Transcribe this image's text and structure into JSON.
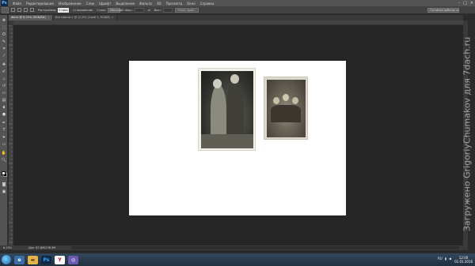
{
  "menubar": {
    "logo": "Ps",
    "items": [
      "Файл",
      "Редактирование",
      "Изображение",
      "Слои",
      "Шрифт",
      "Выделение",
      "Фильтр",
      "3D",
      "Просмотр",
      "Окно",
      "Справка"
    ]
  },
  "options": {
    "feather_label": "Растушевка:",
    "feather_value": "0 пикс",
    "antialias_label": "Сглаживание",
    "style_label": "Стиль:",
    "style_value": "Обычный",
    "width_label": "Шир.:",
    "height_label": "Выс.:",
    "refine_button": "Уточн. край...",
    "workspace": "Основная рабочая среда"
  },
  "tabs": [
    {
      "label": "Фото @ 6,25% (RGB/8#)",
      "active": true
    },
    {
      "label": "Без имени-1 @ 12,5% (Слой 1, RGB/8)",
      "active": false
    }
  ],
  "status": {
    "zoom": "6,25%",
    "doc": "Док: 87,8M/136,9M"
  },
  "taskbar": {
    "apps": [
      "start",
      "explorer",
      "folder",
      "photoshop",
      "yandex-browser",
      "app"
    ],
    "tray": "RU",
    "time": "12:00",
    "date": "01.01.2016"
  },
  "watermark": "Загружено GrigoriyChumakov для 7dach.ru",
  "colors": {
    "workspace": "#262626",
    "chrome": "#535353",
    "document": "#ffffff",
    "photoshop_blue": "#31a8ff"
  }
}
